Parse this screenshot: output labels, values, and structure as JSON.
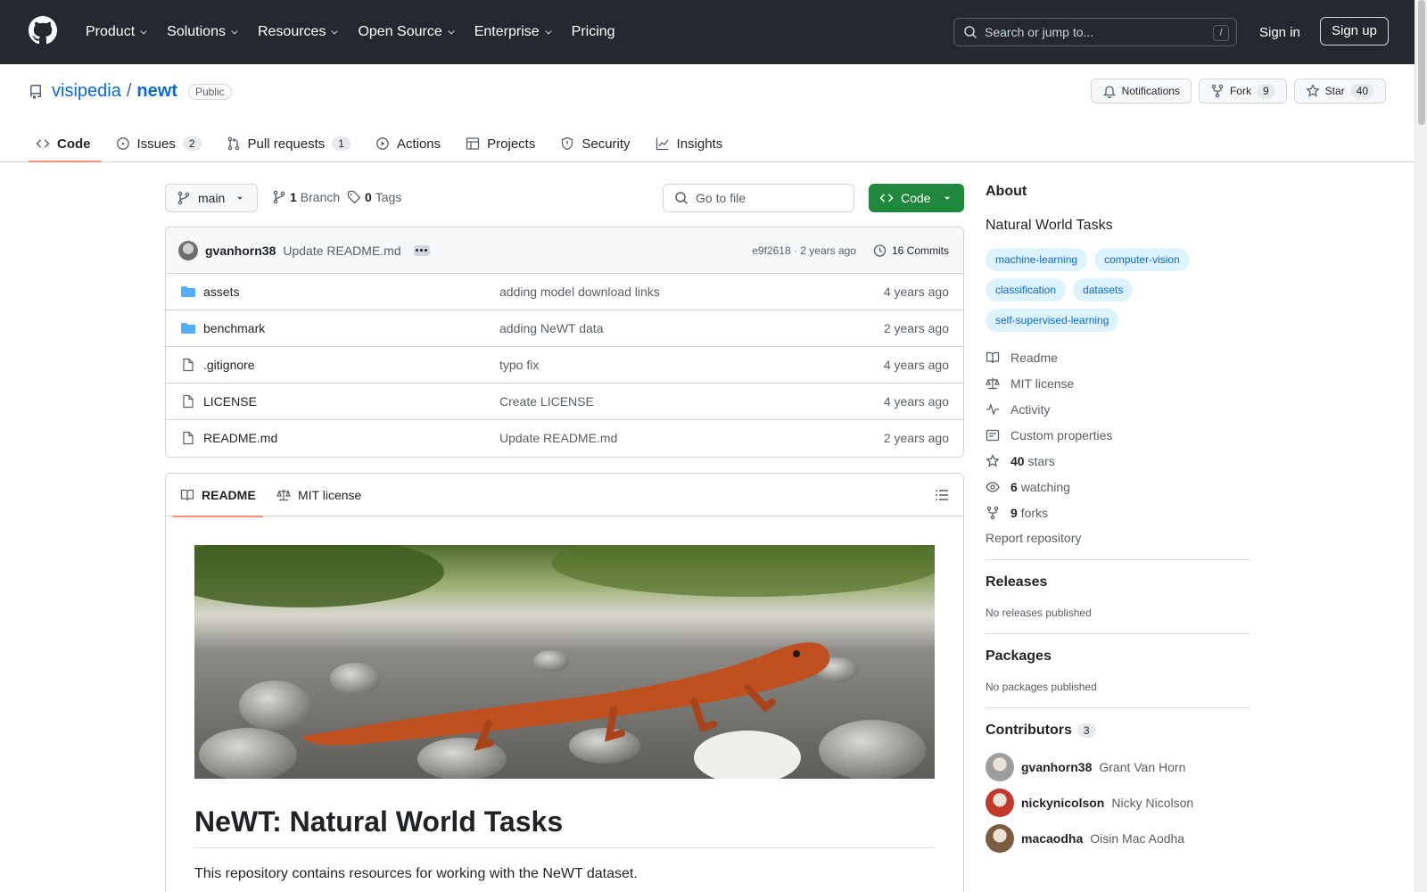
{
  "header": {
    "nav": [
      {
        "label": "Product",
        "dropdown": true
      },
      {
        "label": "Solutions",
        "dropdown": true
      },
      {
        "label": "Resources",
        "dropdown": true
      },
      {
        "label": "Open Source",
        "dropdown": true
      },
      {
        "label": "Enterprise",
        "dropdown": true
      },
      {
        "label": "Pricing",
        "dropdown": false
      }
    ],
    "search_placeholder": "Search or jump to...",
    "search_kbd": "/",
    "signin": "Sign in",
    "signup": "Sign up"
  },
  "repo": {
    "owner": "visipedia",
    "sep": "/",
    "name": "newt",
    "visibility": "Public",
    "notifications": "Notifications",
    "fork_label": "Fork",
    "fork_count": "9",
    "star_label": "Star",
    "star_count": "40"
  },
  "tabs": [
    {
      "label": "Code",
      "count": ""
    },
    {
      "label": "Issues",
      "count": "2"
    },
    {
      "label": "Pull requests",
      "count": "1"
    },
    {
      "label": "Actions",
      "count": ""
    },
    {
      "label": "Projects",
      "count": ""
    },
    {
      "label": "Security",
      "count": ""
    },
    {
      "label": "Insights",
      "count": ""
    }
  ],
  "filenav": {
    "branch": "main",
    "branch_count": "1",
    "branch_label": "Branch",
    "tag_count": "0",
    "tag_label": "Tags",
    "goto_placeholder": "Go to file",
    "code_button": "Code"
  },
  "commit": {
    "user": "gvanhorn38",
    "message": "Update README.md",
    "hash_age": "e9f2618 · 2 years ago",
    "commits": "16 Commits"
  },
  "files": [
    {
      "type": "folder",
      "name": "assets",
      "message": "adding model download links",
      "age": "4 years ago"
    },
    {
      "type": "folder",
      "name": "benchmark",
      "message": "adding NeWT data",
      "age": "2 years ago"
    },
    {
      "type": "file",
      "name": ".gitignore",
      "message": "typo fix",
      "age": "4 years ago"
    },
    {
      "type": "file",
      "name": "LICENSE",
      "message": "Create LICENSE",
      "age": "4 years ago"
    },
    {
      "type": "file",
      "name": "README.md",
      "message": "Update README.md",
      "age": "2 years ago"
    }
  ],
  "readme": {
    "tab_readme": "README",
    "tab_license": "MIT license",
    "title": "NeWT: Natural World Tasks",
    "intro": "This repository contains resources for working with the NeWT dataset."
  },
  "sidebar": {
    "about_title": "About",
    "description": "Natural World Tasks",
    "topics": [
      "machine-learning",
      "computer-vision",
      "classification",
      "datasets",
      "self-supervised-learning"
    ],
    "links": [
      {
        "icon": "book-icon",
        "strong": "",
        "label": "Readme"
      },
      {
        "icon": "scale-icon",
        "strong": "",
        "label": "MIT license"
      },
      {
        "icon": "pulse-icon",
        "strong": "",
        "label": "Activity"
      },
      {
        "icon": "note-icon",
        "strong": "",
        "label": "Custom properties"
      },
      {
        "icon": "star-icon",
        "strong": "40",
        "label": "stars"
      },
      {
        "icon": "eye-icon",
        "strong": "6",
        "label": "watching"
      },
      {
        "icon": "fork-icon",
        "strong": "9",
        "label": "forks"
      }
    ],
    "report": "Report repository",
    "releases_title": "Releases",
    "releases_text": "No releases published",
    "packages_title": "Packages",
    "packages_text": "No packages published",
    "contributors_title": "Contributors",
    "contributors_count": "3",
    "contributors": [
      {
        "login": "gvanhorn38",
        "name": "Grant Van Horn",
        "color": "#9e9e9e"
      },
      {
        "login": "nickynicolson",
        "name": "Nicky Nicolson",
        "color": "#c0392b"
      },
      {
        "login": "macaodha",
        "name": "Oisin Mac Aodha",
        "color": "#7a5c3e"
      }
    ]
  },
  "colors": {
    "header_bg": "#24292f",
    "link": "#0969da",
    "code_button": "#1f883d",
    "tab_underline": "#fd8c73",
    "topic_bg": "#ddf4ff"
  }
}
